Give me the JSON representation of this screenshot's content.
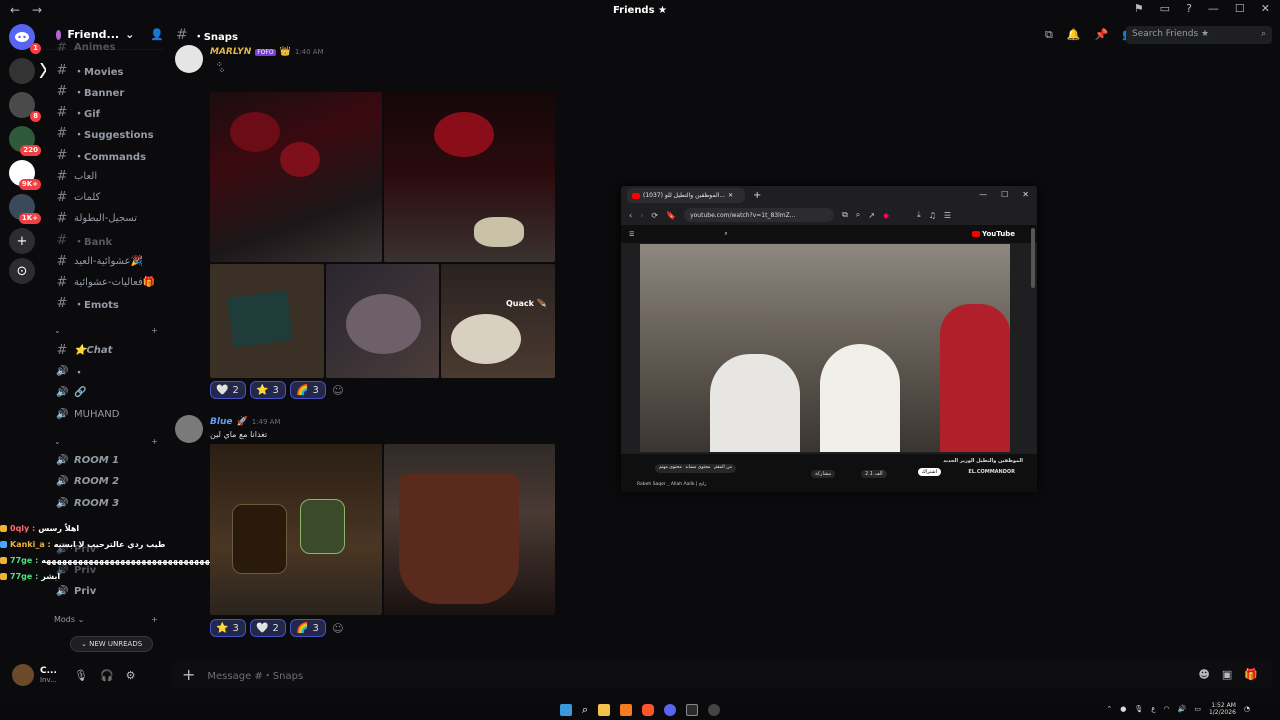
{
  "window": {
    "title": "Friends ★",
    "nav_back": "←",
    "nav_forward": "→"
  },
  "servers": {
    "badges": [
      "1",
      "8",
      "220",
      "9K+",
      "1K+"
    ],
    "x_letter": "X",
    "add": "+",
    "explore": "⊙"
  },
  "guild": {
    "name": "Friend...",
    "chevron": "⌄"
  },
  "channels": {
    "top_cut": "Animes",
    "list1": [
      "・Movies",
      "・Banner",
      "・Gif",
      "・Suggestions",
      "・Commands",
      "العاب",
      "كلمات",
      "تسجيل-البطولة"
    ],
    "bank": "・Bank",
    "arabic2": [
      "عشوائية-العيد🎉",
      "فعاليات-عشوائية🎁"
    ],
    "emots": "・Emots",
    "cat1": "⌄",
    "chat": "⭐Chat",
    "voice_dot": "・",
    "link_icon": "🔗",
    "muhand": "MUHAND",
    "cat2": "⌄",
    "rooms": [
      "ROOM 1",
      "ROOM 2",
      "ROOM 3"
    ],
    "privs": [
      "Priv",
      "Priv",
      "Priv"
    ],
    "mods": "Mods ⌄"
  },
  "overlay_chat": {
    "lines": [
      {
        "user": "0qly :",
        "text": "اهلاً رسس"
      },
      {
        "user": "Kanki_a :",
        "text": "طيب ردي عالترحيب لا ابسبه"
      },
      {
        "user": "77ge :",
        "text": "ههههههههههههههههههههههههههههههههههههههههه"
      },
      {
        "user": "77ge :",
        "text": "ابشر"
      }
    ]
  },
  "new_unreads": "NEW UNREADS",
  "user": {
    "name": "C...",
    "status": "Inv..."
  },
  "topbar": {
    "channel": "・Snaps",
    "search_placeholder": "Search Friends ★"
  },
  "messages": [
    {
      "author": "MARLYN",
      "badge": "FOFO",
      "crown": "👑",
      "time": "1:40 AM",
      "text": "",
      "caption": "Quack 🪶",
      "reactions": [
        {
          "emoji": "🤍",
          "count": "2"
        },
        {
          "emoji": "⭐",
          "count": "3"
        },
        {
          "emoji": "🌈",
          "count": "3"
        }
      ]
    },
    {
      "author": "Blue",
      "badge": "🚀",
      "time": "1:49 AM",
      "text": "تغدانا مع ماي لين",
      "reactions": [
        {
          "emoji": "⭐",
          "count": "3"
        },
        {
          "emoji": "🤍",
          "count": "2"
        },
        {
          "emoji": "🌈",
          "count": "3"
        }
      ]
    }
  ],
  "composer": {
    "placeholder": "Message #・Snaps",
    "plus": "+"
  },
  "browser": {
    "tab_title": "(1037) الموظفين والتطيل للو...",
    "url": "youtube.com/watch?v=1t_83lmZ...",
    "yt_brand": "YouTube",
    "video_title": "الموظفين والتطيل الوزير الجديد",
    "channel": "EL.COMMANDOR",
    "subscribe": "اشتراك",
    "likes": "2.1 ألف",
    "share": "مشاركة",
    "playlist": "Rabeh Saqer _ Allah Aalik | رابح",
    "chips": [
      "من المقترحات",
      "محتوى مشابه",
      "محتوى مهتم"
    ]
  },
  "taskbar": {
    "time": "1:52 AM",
    "date": "1/2/2026",
    "lang": "ع"
  },
  "colors": {
    "accent": "#5865f2",
    "badge": "#f23f43",
    "author": "#e0b74a",
    "blue_author": "#5ea0ff",
    "bg": "#0b0b0d"
  }
}
